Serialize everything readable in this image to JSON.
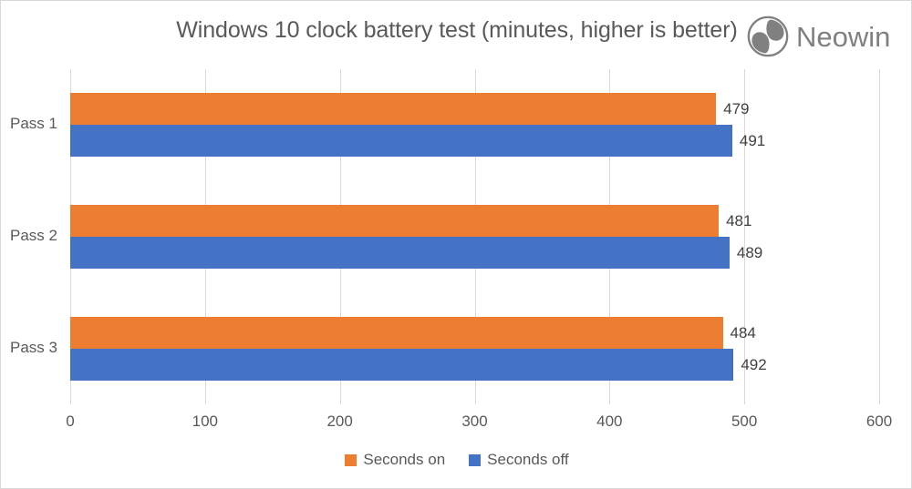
{
  "chart_data": {
    "type": "bar",
    "orientation": "horizontal",
    "title": "Windows 10 clock battery test (minutes, higher is better)",
    "xlabel": "",
    "ylabel": "",
    "xlim": [
      0,
      600
    ],
    "xticks": [
      0,
      100,
      200,
      300,
      400,
      500,
      600
    ],
    "grid": true,
    "legend_position": "bottom",
    "categories": [
      "Pass 1",
      "Pass 2",
      "Pass 3"
    ],
    "series": [
      {
        "name": "Seconds on",
        "color": "#ED7D31",
        "values": [
          479,
          481,
          484
        ]
      },
      {
        "name": "Seconds off",
        "color": "#4472C4",
        "values": [
          491,
          489,
          492
        ]
      }
    ],
    "data_labels": {
      "Pass 1": {
        "Seconds on": "479",
        "Seconds off": "491"
      },
      "Pass 2": {
        "Seconds on": "481",
        "Seconds off": "489"
      },
      "Pass 3": {
        "Seconds on": "484",
        "Seconds off": "492"
      }
    }
  },
  "watermark": {
    "brand": "Neowin",
    "mark_icon": "neowin-logo-icon"
  },
  "axis": {
    "tick_labels": [
      "0",
      "100",
      "200",
      "300",
      "400",
      "500",
      "600"
    ],
    "category_labels": [
      "Pass 1",
      "Pass 2",
      "Pass 3"
    ]
  },
  "legend": {
    "items": [
      {
        "label": "Seconds on",
        "color": "#ED7D31"
      },
      {
        "label": "Seconds off",
        "color": "#4472C4"
      }
    ]
  },
  "colors": {
    "series_on": "#ED7D31",
    "series_off": "#4472C4",
    "gridline": "#D9D9D9",
    "text": "#595959",
    "label_text": "#404040",
    "border": "#D9D9D9"
  }
}
